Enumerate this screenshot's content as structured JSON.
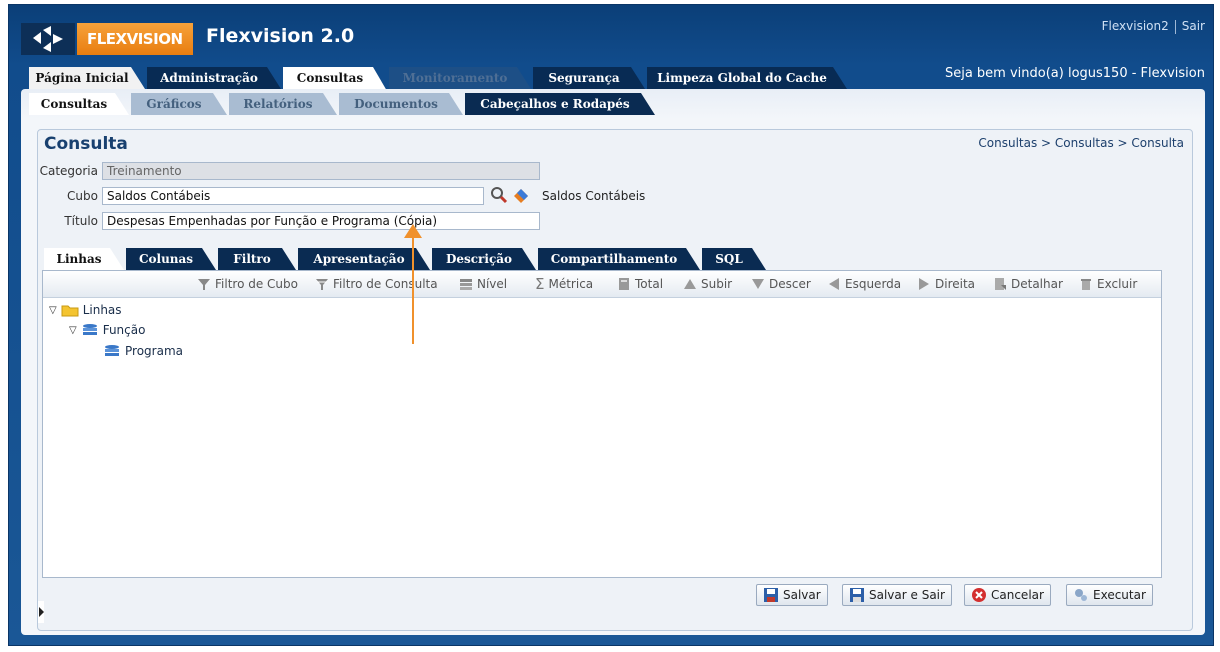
{
  "header": {
    "brand": "FLEXVISION",
    "app_title": "Flexvision 2.0",
    "user_link": "Flexvision2",
    "logout_link": "Sair",
    "welcome": "Seja bem vindo(a) logus150 - Flexvision"
  },
  "main_tabs": [
    {
      "label": "Página Inicial"
    },
    {
      "label": "Administração"
    },
    {
      "label": "Consultas"
    },
    {
      "label": "Monitoramento"
    },
    {
      "label": "Segurança"
    },
    {
      "label": "Limpeza Global do Cache"
    }
  ],
  "sub_tabs": [
    {
      "label": "Consultas"
    },
    {
      "label": "Gráficos"
    },
    {
      "label": "Relatórios"
    },
    {
      "label": "Documentos"
    },
    {
      "label": "Cabeçalhos e Rodapés"
    }
  ],
  "page": {
    "title": "Consulta",
    "breadcrumb": "Consultas > Consultas > Consulta"
  },
  "form": {
    "categoria_label": "Categoria",
    "categoria_value": "Treinamento",
    "cubo_label": "Cubo",
    "cubo_value": "Saldos Contábeis",
    "cubo_description": "Saldos Contábeis",
    "titulo_label": "Título",
    "titulo_value": "Despesas Empenhadas por Função e Programa (Cópia)"
  },
  "inner_tabs": [
    {
      "label": "Linhas"
    },
    {
      "label": "Colunas"
    },
    {
      "label": "Filtro"
    },
    {
      "label": "Apresentação"
    },
    {
      "label": "Descrição"
    },
    {
      "label": "Compartilhamento"
    },
    {
      "label": "SQL"
    }
  ],
  "toolbar": {
    "filtro_cubo": "Filtro de Cubo",
    "filtro_consulta": "Filtro de Consulta",
    "nivel": "Nível",
    "metrica": "Métrica",
    "total": "Total",
    "subir": "Subir",
    "descer": "Descer",
    "esquerda": "Esquerda",
    "direita": "Direita",
    "detalhar": "Detalhar",
    "excluir": "Excluir"
  },
  "tree": {
    "root": "Linhas",
    "level1": "Função",
    "level2": "Programa"
  },
  "buttons": {
    "salvar": "Salvar",
    "salvar_sair": "Salvar e Sair",
    "cancelar": "Cancelar",
    "executar": "Executar"
  },
  "colors": {
    "header_blue": "#114c8c",
    "brand_orange": "#f0912c",
    "dark_tab": "#0a2b52",
    "annotation_arrow": "#f0912c"
  }
}
